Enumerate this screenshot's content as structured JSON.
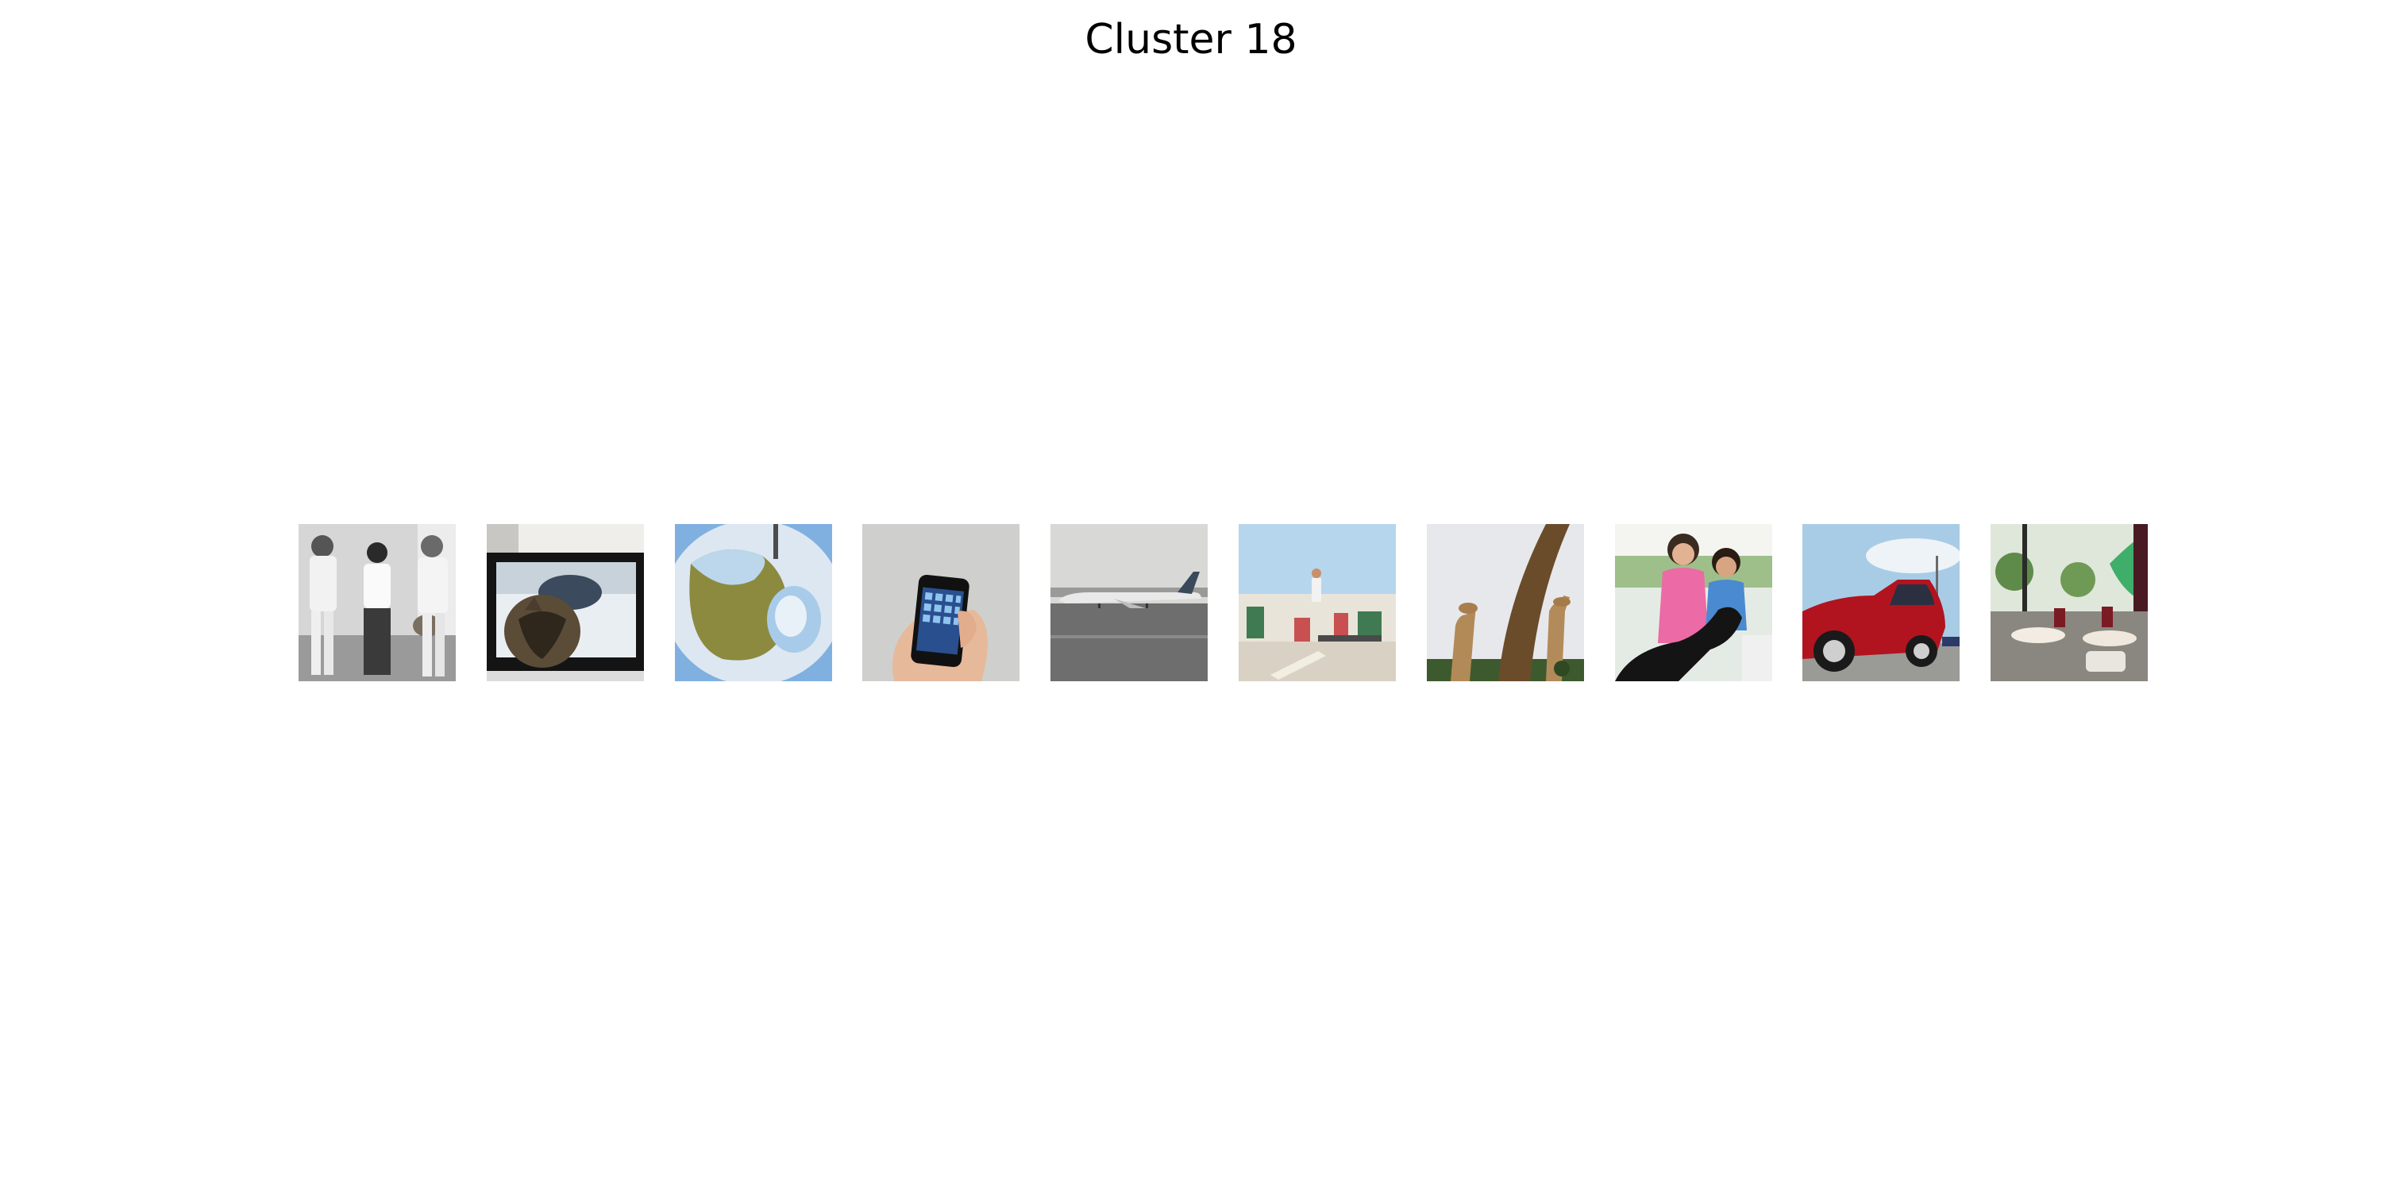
{
  "figure": {
    "title": "Cluster 18"
  },
  "thumbnails": [
    {
      "name": "photo-baseball-players"
    },
    {
      "name": "photo-cat-tv"
    },
    {
      "name": "photo-cake-plate"
    },
    {
      "name": "photo-phone-hand"
    },
    {
      "name": "photo-airplane-runway"
    },
    {
      "name": "photo-skateboarder"
    },
    {
      "name": "photo-giraffes"
    },
    {
      "name": "photo-girls-goat"
    },
    {
      "name": "photo-red-truck"
    },
    {
      "name": "photo-dining-table"
    }
  ]
}
